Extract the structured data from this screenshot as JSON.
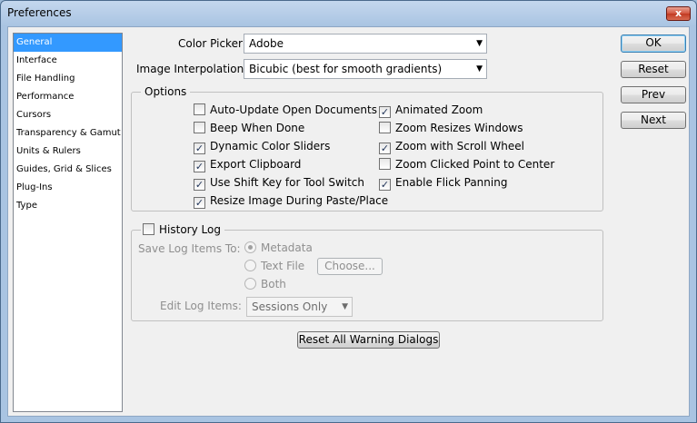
{
  "window": {
    "title": "Preferences",
    "close_glyph": "x"
  },
  "sidebar": {
    "items": [
      {
        "label": "General",
        "selected": true
      },
      {
        "label": "Interface"
      },
      {
        "label": "File Handling"
      },
      {
        "label": "Performance"
      },
      {
        "label": "Cursors"
      },
      {
        "label": "Transparency & Gamut"
      },
      {
        "label": "Units & Rulers"
      },
      {
        "label": "Guides, Grid & Slices"
      },
      {
        "label": "Plug-Ins"
      },
      {
        "label": "Type"
      }
    ]
  },
  "general": {
    "color_picker_label": "Color Picker:",
    "color_picker_value": "Adobe",
    "interp_label": "Image Interpolation:",
    "interp_value": "Bicubic (best for smooth gradients)"
  },
  "options": {
    "title": "Options",
    "left": [
      {
        "label": "Auto-Update Open Documents",
        "checked": false
      },
      {
        "label": "Beep When Done",
        "checked": false
      },
      {
        "label": "Dynamic Color Sliders",
        "checked": true
      },
      {
        "label": "Export Clipboard",
        "checked": true
      },
      {
        "label": "Use Shift Key for Tool Switch",
        "checked": true
      },
      {
        "label": "Resize Image During Paste/Place",
        "checked": true
      }
    ],
    "right": [
      {
        "label": "Animated Zoom",
        "checked": true
      },
      {
        "label": "Zoom Resizes Windows",
        "checked": false
      },
      {
        "label": "Zoom with Scroll Wheel",
        "checked": true
      },
      {
        "label": "Zoom Clicked Point to Center",
        "checked": false
      },
      {
        "label": "Enable Flick Panning",
        "checked": true
      }
    ]
  },
  "history": {
    "label": "History Log",
    "checked": false,
    "save_label": "Save Log Items To:",
    "radios": [
      {
        "label": "Metadata",
        "selected": true
      },
      {
        "label": "Text File",
        "selected": false
      },
      {
        "label": "Both",
        "selected": false
      }
    ],
    "choose_label": "Choose...",
    "edit_label": "Edit Log Items:",
    "edit_value": "Sessions Only"
  },
  "buttons": {
    "ok": "OK",
    "reset": "Reset",
    "prev": "Prev",
    "next": "Next",
    "reset_warnings": "Reset All Warning Dialogs"
  },
  "check_glyph": "✓",
  "arrow_glyph": "▼"
}
